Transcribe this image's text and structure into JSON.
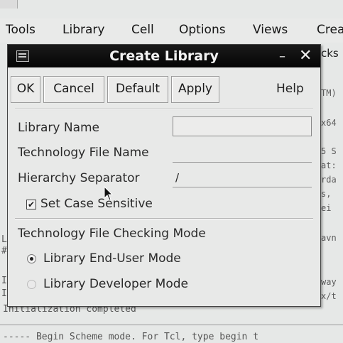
{
  "menubar": {
    "items": [
      "Tools",
      "Library",
      "Cell",
      "Options",
      "Views",
      "Crea"
    ]
  },
  "background_terminal": {
    "line_frag_1": "L",
    "line_frag_2": "#",
    "line_frag_3": "I",
    "line_frag_4": "I",
    "init_line": "Initialization completed",
    "scheme_line": "----- Begin Scheme mode. For Tcl, type begin t"
  },
  "background_right_column": {
    "fragments": [
      "cks",
      "TM)",
      "x64",
      "5 S",
      "at:",
      "rda",
      "s,",
      "ei",
      "avn",
      "way",
      "x/t"
    ]
  },
  "dialog": {
    "title": "Create Library",
    "buttons": {
      "ok": "OK",
      "cancel": "Cancel",
      "default": "Default",
      "apply": "Apply",
      "help": "Help"
    },
    "fields": {
      "library_name": {
        "label": "Library Name",
        "value": ""
      },
      "technology_file_name": {
        "label": "Technology File Name",
        "value": ""
      },
      "hierarchy_separator": {
        "label": "Hierarchy Separator",
        "value": "/"
      }
    },
    "case_sensitive": {
      "label": "Set Case Sensitive",
      "checked": true,
      "mark": "✔"
    },
    "tech_checking_mode": {
      "label": "Technology File Checking Mode",
      "options": [
        {
          "label": "Library End-User Mode",
          "selected": true
        },
        {
          "label": "Library Developer Mode",
          "selected": false
        }
      ]
    },
    "icons": {
      "window_menu": "window-menu-icon",
      "minimize": "–",
      "close": "✕"
    }
  }
}
